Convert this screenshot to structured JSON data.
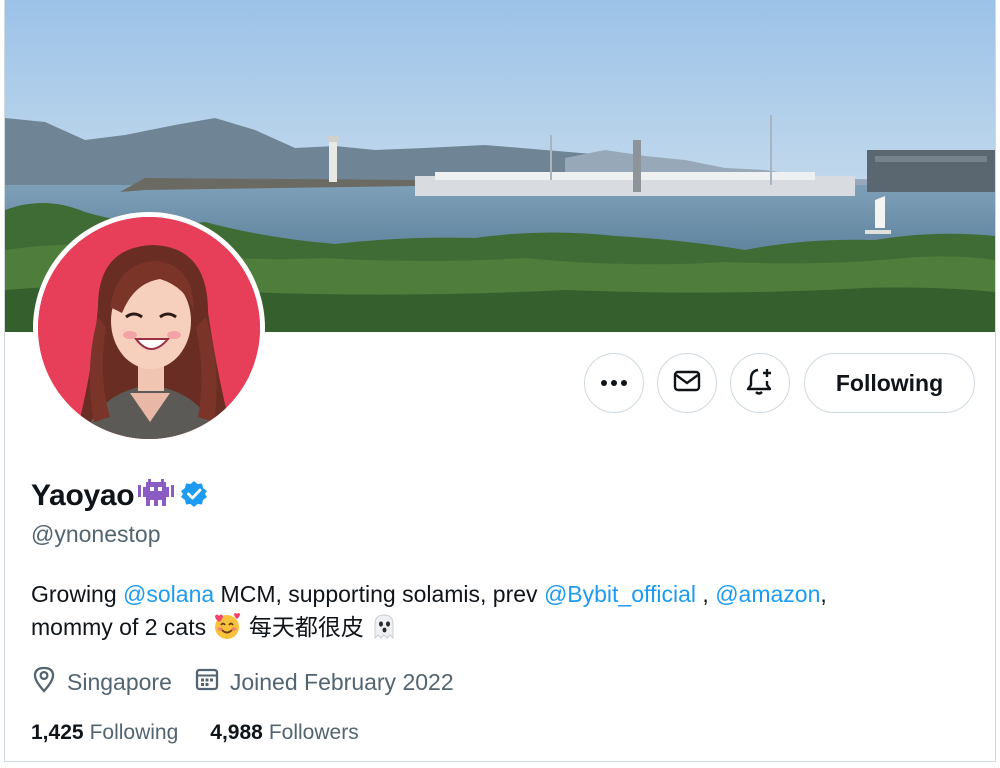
{
  "profile": {
    "display_name": "Yaoyao",
    "handle": "@ynonestop",
    "name_emoji_icon": "space-invader-icon",
    "verified_icon": "verified-badge-icon"
  },
  "actions": {
    "more_icon": "more-options-icon",
    "message_icon": "envelope-icon",
    "notify_icon": "bell-plus-icon",
    "following_label": "Following"
  },
  "bio": {
    "text_1": "Growing ",
    "mention_1": "@solana",
    "text_2": " MCM, supporting solamis, prev ",
    "mention_2": "@Bybit_official",
    "text_3": " , ",
    "mention_3": "@amazon",
    "text_4": ",",
    "text_5": "mommy of 2 cats ",
    "emoji_1": "smiling-face-with-hearts-icon",
    "text_6": " 每天都很皮 ",
    "emoji_2": "ghost-icon"
  },
  "meta": {
    "location": "Singapore",
    "joined": "Joined February 2022"
  },
  "stats": {
    "following_count": "1,425",
    "following_label": "Following",
    "followers_count": "4,988",
    "followers_label": "Followers"
  },
  "colors": {
    "link": "#1d9bf0",
    "secondary_text": "#536471",
    "verified": "#1d9bf0",
    "avatar_bg": "#e73f5a"
  }
}
